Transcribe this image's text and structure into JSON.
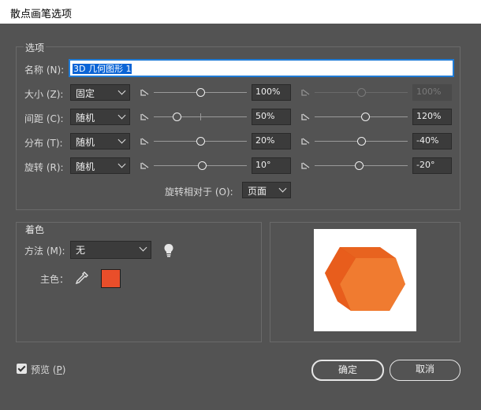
{
  "window": {
    "title": "散点画笔选项"
  },
  "options": {
    "group_label": "选项",
    "name_label": "名称 (N):",
    "name_value": "3D 几何图形 1",
    "rows": [
      {
        "label": "大小 (Z):",
        "mode": "固定",
        "value1": "100%",
        "value2": "100%",
        "slider1": 0.5,
        "slider2": 0.5,
        "second_disabled": true
      },
      {
        "label": "间距 (C):",
        "mode": "随机",
        "value1": "50%",
        "value2": "120%",
        "slider1": 0.25,
        "slider2": 0.55,
        "second_disabled": false
      },
      {
        "label": "分布 (T):",
        "mode": "随机",
        "value1": "20%",
        "value2": "-40%",
        "slider1": 0.5,
        "slider2": 0.5,
        "second_disabled": false
      },
      {
        "label": "旋转 (R):",
        "mode": "随机",
        "value1": "10°",
        "value2": "-20°",
        "slider1": 0.52,
        "slider2": 0.48,
        "second_disabled": false
      }
    ],
    "rotation_relative_label": "旋转相对于 (O):",
    "rotation_relative_value": "页面"
  },
  "colorization": {
    "group_label": "着色",
    "method_label": "方法 (M):",
    "method_value": "无",
    "tips_icon": "lightbulb-icon",
    "key_color_label": "主色：",
    "eyedropper_icon": "eyedropper-icon",
    "key_color": "#e94e2a"
  },
  "preview_art": {
    "shape": "hexagonal-prism",
    "colors": [
      "#e85d1c",
      "#f07b30",
      "#c64a10"
    ]
  },
  "footer": {
    "preview_label": "预览",
    "preview_hotkey": "P",
    "preview_checked": true,
    "ok_label": "确定",
    "cancel_label": "取消"
  }
}
